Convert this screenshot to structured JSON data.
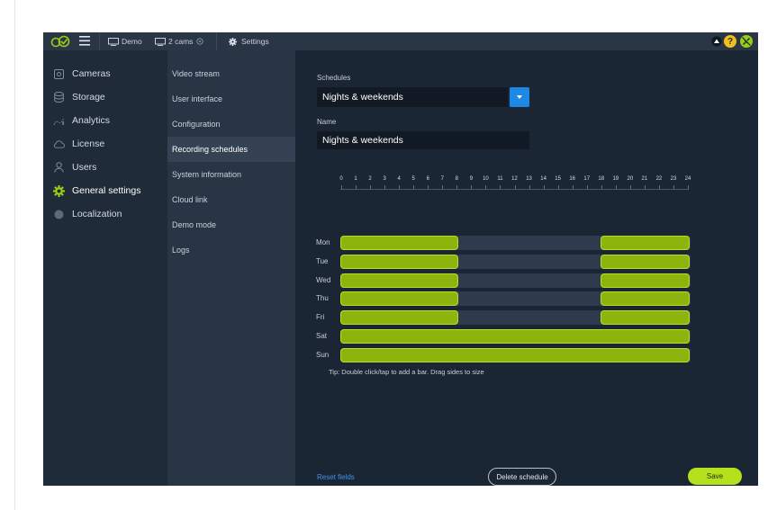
{
  "topbar": {
    "demo_label": "Demo",
    "cams_label": "2 cams",
    "settings_label": "Settings",
    "help_glyph": "?"
  },
  "sidebar": {
    "items": [
      {
        "label": "Cameras",
        "icon": "camera-icon"
      },
      {
        "label": "Storage",
        "icon": "database-icon"
      },
      {
        "label": "Analytics",
        "icon": "analytics-icon"
      },
      {
        "label": "License",
        "icon": "cloud-icon"
      },
      {
        "label": "Users",
        "icon": "user-icon"
      },
      {
        "label": "General settings",
        "icon": "gear-icon",
        "active": true
      },
      {
        "label": "Localization",
        "icon": "globe-icon"
      }
    ]
  },
  "subnav": {
    "items": [
      {
        "label": "Video stream"
      },
      {
        "label": "User interface"
      },
      {
        "label": "Configuration"
      },
      {
        "label": "Recording schedules",
        "active": true
      },
      {
        "label": "System information"
      },
      {
        "label": "Cloud link"
      },
      {
        "label": "Demo mode"
      },
      {
        "label": "Logs"
      }
    ]
  },
  "main": {
    "schedules_label": "Schedules",
    "schedule_selected": "Nights & weekends",
    "name_label": "Name",
    "name_value": "Nights & weekends",
    "hours": [
      "0",
      "1",
      "2",
      "3",
      "4",
      "5",
      "6",
      "7",
      "8",
      "9",
      "10",
      "11",
      "12",
      "13",
      "14",
      "15",
      "16",
      "17",
      "18",
      "19",
      "20",
      "21",
      "22",
      "23",
      "24"
    ],
    "days": [
      {
        "label": "Mon",
        "ranges": [
          [
            0,
            8
          ],
          [
            18,
            24
          ]
        ]
      },
      {
        "label": "Tue",
        "ranges": [
          [
            0,
            8
          ],
          [
            18,
            24
          ]
        ]
      },
      {
        "label": "Wed",
        "ranges": [
          [
            0,
            8
          ],
          [
            18,
            24
          ]
        ]
      },
      {
        "label": "Thu",
        "ranges": [
          [
            0,
            8
          ],
          [
            18,
            24
          ]
        ]
      },
      {
        "label": "Fri",
        "ranges": [
          [
            0,
            8
          ],
          [
            18,
            24
          ]
        ]
      },
      {
        "label": "Sat",
        "ranges": [
          [
            0,
            24
          ]
        ]
      },
      {
        "label": "Sun",
        "ranges": [
          [
            0,
            24
          ]
        ]
      }
    ],
    "tip": "Tip: Double click/tap to add a bar. Drag sides to size",
    "reset_label": "Reset fields",
    "delete_label": "Delete schedule",
    "save_label": "Save"
  },
  "colors": {
    "accent_green": "#b5e11c",
    "bar_green": "#8cb40c",
    "select_blue": "#1e88e5",
    "link_blue": "#3f93e8",
    "background": "#1b2634"
  }
}
